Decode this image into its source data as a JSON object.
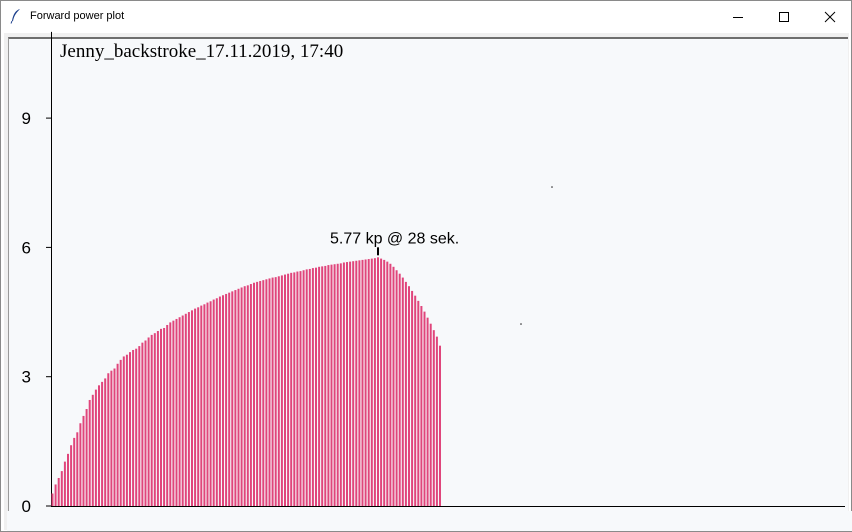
{
  "window": {
    "title": "Forward power plot",
    "minimize_glyph": "—",
    "maximize_glyph": "☐",
    "close_glyph": "✕",
    "app_icon": "feather-icon"
  },
  "chart_data": {
    "type": "bar",
    "title": "Jenny_backstroke_17.11.2019, 17:40",
    "xlabel": "",
    "ylabel": "",
    "ylim": [
      0,
      11
    ],
    "yticks": [
      "0",
      "3",
      "6",
      "9"
    ],
    "ytick_values": [
      0,
      3,
      6,
      9
    ],
    "bar_color": "#e0457b",
    "annotation": "5.77 kp @ 28 sek.",
    "annotation_index": 105,
    "grid": false,
    "series": [
      {
        "values": [
          0.29,
          0.5,
          0.65,
          0.81,
          1.03,
          1.21,
          1.41,
          1.58,
          1.71,
          1.92,
          2.09,
          2.25,
          2.46,
          2.58,
          2.7,
          2.8,
          2.88,
          2.96,
          3.08,
          3.14,
          3.19,
          3.3,
          3.39,
          3.47,
          3.51,
          3.57,
          3.62,
          3.65,
          3.71,
          3.79,
          3.84,
          3.91,
          3.97,
          4.01,
          4.06,
          4.11,
          4.13,
          4.2,
          4.26,
          4.3,
          4.34,
          4.38,
          4.42,
          4.46,
          4.5,
          4.54,
          4.58,
          4.61,
          4.65,
          4.68,
          4.72,
          4.75,
          4.79,
          4.82,
          4.86,
          4.89,
          4.92,
          4.95,
          4.98,
          5.01,
          5.04,
          5.07,
          5.1,
          5.12,
          5.15,
          5.18,
          5.2,
          5.22,
          5.24,
          5.26,
          5.28,
          5.3,
          5.31,
          5.33,
          5.35,
          5.37,
          5.39,
          5.41,
          5.42,
          5.44,
          5.45,
          5.47,
          5.49,
          5.5,
          5.52,
          5.53,
          5.55,
          5.56,
          5.57,
          5.59,
          5.6,
          5.61,
          5.62,
          5.63,
          5.65,
          5.66,
          5.67,
          5.68,
          5.69,
          5.7,
          5.71,
          5.72,
          5.73,
          5.74,
          5.75,
          5.77,
          5.74,
          5.71,
          5.67,
          5.62,
          5.55,
          5.47,
          5.39,
          5.3,
          5.2,
          5.1,
          4.99,
          4.88,
          4.76,
          4.64,
          4.51,
          4.37,
          4.23,
          4.08,
          3.93,
          3.72
        ]
      }
    ]
  }
}
